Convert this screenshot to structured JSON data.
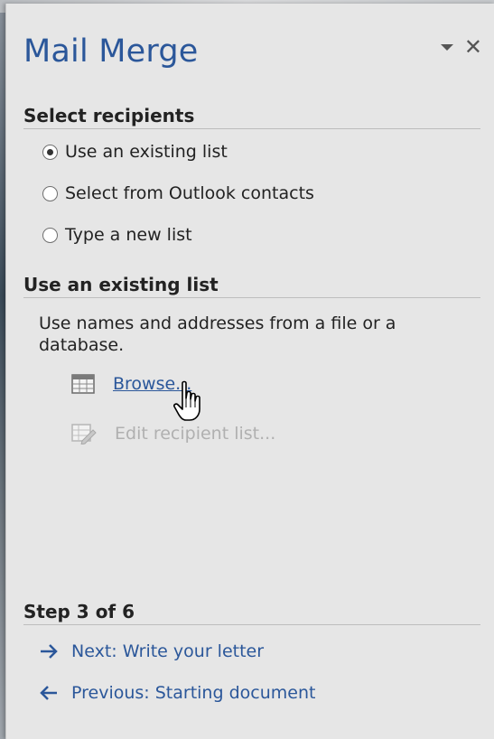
{
  "pane": {
    "title": "Mail Merge",
    "dropdown_icon": "triangle-down-icon",
    "close_icon": "close-icon",
    "close_glyph": "✕"
  },
  "select_recipients": {
    "heading": "Select recipients",
    "options": [
      {
        "label": "Use an existing list",
        "selected": true
      },
      {
        "label": "Select from Outlook contacts",
        "selected": false
      },
      {
        "label": "Type a new list",
        "selected": false
      }
    ]
  },
  "existing_list": {
    "heading": "Use an existing list",
    "description": "Use names and addresses from a file or a database.",
    "browse_label": "Browse...",
    "edit_label": "Edit recipient list...",
    "browse_icon": "table-icon",
    "edit_icon": "edit-list-icon",
    "edit_disabled": true
  },
  "step": {
    "heading": "Step 3 of 6",
    "next_label": "Next: Write your letter",
    "previous_label": "Previous: Starting document",
    "next_icon": "arrow-right-icon",
    "previous_icon": "arrow-left-icon"
  },
  "colors": {
    "accent": "#2b579a",
    "pane_bg": "#e6e6e6",
    "disabled_text": "#b0b0b0"
  }
}
